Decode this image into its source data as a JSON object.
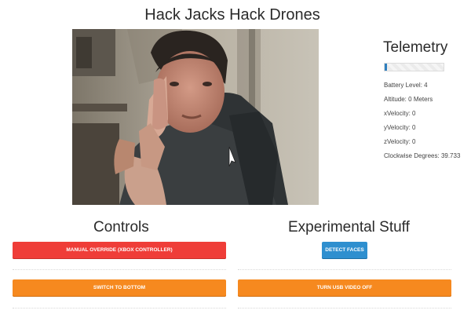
{
  "header": {
    "title": "Hack Jacks Hack Drones"
  },
  "telemetry": {
    "title": "Telemetry",
    "battery_progress": 0.04,
    "battery_color": "#2f7fbf",
    "items": [
      {
        "label": "Battery Level:",
        "value": "4"
      },
      {
        "label": "Altitude:",
        "value": "0 Meters"
      },
      {
        "label": "xVelocity:",
        "value": "0"
      },
      {
        "label": "yVelocity:",
        "value": "0"
      },
      {
        "label": "zVelocity:",
        "value": "0"
      },
      {
        "label": "Clockwise Degrees:",
        "value": "39.733"
      }
    ]
  },
  "controls": {
    "title": "Controls",
    "manual_override_label": "MANUAL OVERRIDE (XBOX CONTROLLER)",
    "switch_bottom_label": "SWITCH TO BOTTOM"
  },
  "experimental": {
    "title": "Experimental Stuff",
    "detect_faces_label": "DETECT FACES",
    "usb_video_label": "TURN USB VIDEO OFF"
  },
  "colors": {
    "danger": "#ef3d38",
    "warning": "#f6891f",
    "info": "#2e8fcf"
  }
}
